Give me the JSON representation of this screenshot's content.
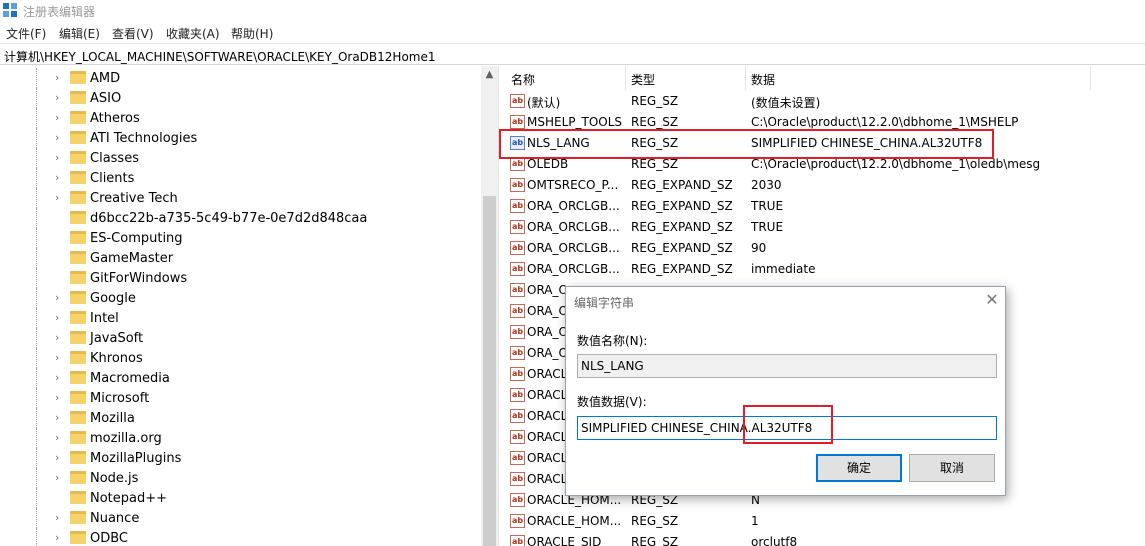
{
  "window": {
    "title": "注册表编辑器"
  },
  "menu": [
    "文件(F)",
    "编辑(E)",
    "查看(V)",
    "收藏夹(A)",
    "帮助(H)"
  ],
  "address": "计算机\\HKEY_LOCAL_MACHINE\\SOFTWARE\\ORACLE\\KEY_OraDB12Home1",
  "tree": {
    "items": [
      {
        "label": "AMD",
        "expandable": true
      },
      {
        "label": "ASIO",
        "expandable": true
      },
      {
        "label": "Atheros",
        "expandable": true
      },
      {
        "label": "ATI Technologies",
        "expandable": true
      },
      {
        "label": "Classes",
        "expandable": true
      },
      {
        "label": "Clients",
        "expandable": true
      },
      {
        "label": "Creative Tech",
        "expandable": true
      },
      {
        "label": "d6bcc22b-a735-5c49-b77e-0e7d2d848caa",
        "expandable": false
      },
      {
        "label": "ES-Computing",
        "expandable": false
      },
      {
        "label": "GameMaster",
        "expandable": false
      },
      {
        "label": "GitForWindows",
        "expandable": false
      },
      {
        "label": "Google",
        "expandable": true
      },
      {
        "label": "Intel",
        "expandable": true
      },
      {
        "label": "JavaSoft",
        "expandable": true
      },
      {
        "label": "Khronos",
        "expandable": true
      },
      {
        "label": "Macromedia",
        "expandable": true
      },
      {
        "label": "Microsoft",
        "expandable": true
      },
      {
        "label": "Mozilla",
        "expandable": true
      },
      {
        "label": "mozilla.org",
        "expandable": true
      },
      {
        "label": "MozillaPlugins",
        "expandable": true
      },
      {
        "label": "Node.js",
        "expandable": true
      },
      {
        "label": "Notepad++",
        "expandable": false
      },
      {
        "label": "Nuance",
        "expandable": true
      },
      {
        "label": "ODBC",
        "expandable": true
      }
    ]
  },
  "list": {
    "headers": {
      "name": "名称",
      "type": "类型",
      "data": "数据"
    },
    "rows": [
      {
        "name": "(默认)",
        "type": "REG_SZ",
        "data": "(数值未设置)"
      },
      {
        "name": "MSHELP_TOOLS",
        "type": "REG_SZ",
        "data": "C:\\Oracle\\product\\12.2.0\\dbhome_1\\MSHELP"
      },
      {
        "name": "NLS_LANG",
        "type": "REG_SZ",
        "data": "SIMPLIFIED CHINESE_CHINA.AL32UTF8",
        "selected": true
      },
      {
        "name": "OLEDB",
        "type": "REG_SZ",
        "data": "C:\\Oracle\\product\\12.2.0\\dbhome_1\\oledb\\mesg"
      },
      {
        "name": "OMTSRECO_P...",
        "type": "REG_EXPAND_SZ",
        "data": "2030"
      },
      {
        "name": "ORA_ORCLGB...",
        "type": "REG_EXPAND_SZ",
        "data": "TRUE"
      },
      {
        "name": "ORA_ORCLGB...",
        "type": "REG_EXPAND_SZ",
        "data": "TRUE"
      },
      {
        "name": "ORA_ORCLGB...",
        "type": "REG_EXPAND_SZ",
        "data": "90"
      },
      {
        "name": "ORA_ORCLGB...",
        "type": "REG_EXPAND_SZ",
        "data": "immediate"
      },
      {
        "name": "ORA_O",
        "type": "",
        "data": ""
      },
      {
        "name": "ORA_O",
        "type": "",
        "data": ""
      },
      {
        "name": "ORA_O",
        "type": "",
        "data": ""
      },
      {
        "name": "ORA_O",
        "type": "",
        "data": ""
      },
      {
        "name": "ORACL",
        "type": "",
        "data": ""
      },
      {
        "name": "ORACL",
        "type": "",
        "data": ""
      },
      {
        "name": "ORACL",
        "type": "",
        "data": ""
      },
      {
        "name": "ORACL",
        "type": "",
        "data": ""
      },
      {
        "name": "ORACL",
        "type": "",
        "data": ""
      },
      {
        "name": "ORACL",
        "type": "",
        "data": ""
      },
      {
        "name": "ORACLE_HOM...",
        "type": "REG_SZ",
        "data": "N"
      },
      {
        "name": "ORACLE_HOM...",
        "type": "REG_SZ",
        "data": "1"
      },
      {
        "name": "ORACLE_SID",
        "type": "REG_SZ",
        "data": "orclutf8"
      }
    ]
  },
  "dialog": {
    "title": "编辑字符串",
    "close": "✕",
    "name_label": "数值名称(N):",
    "name_value": "NLS_LANG",
    "data_label": "数值数据(V):",
    "data_value": "SIMPLIFIED CHINESE_CHINA.AL32UTF8",
    "ok": "确定",
    "cancel": "取消"
  },
  "colors": {
    "highlight": "#e01e28",
    "focus": "#0078d7"
  }
}
